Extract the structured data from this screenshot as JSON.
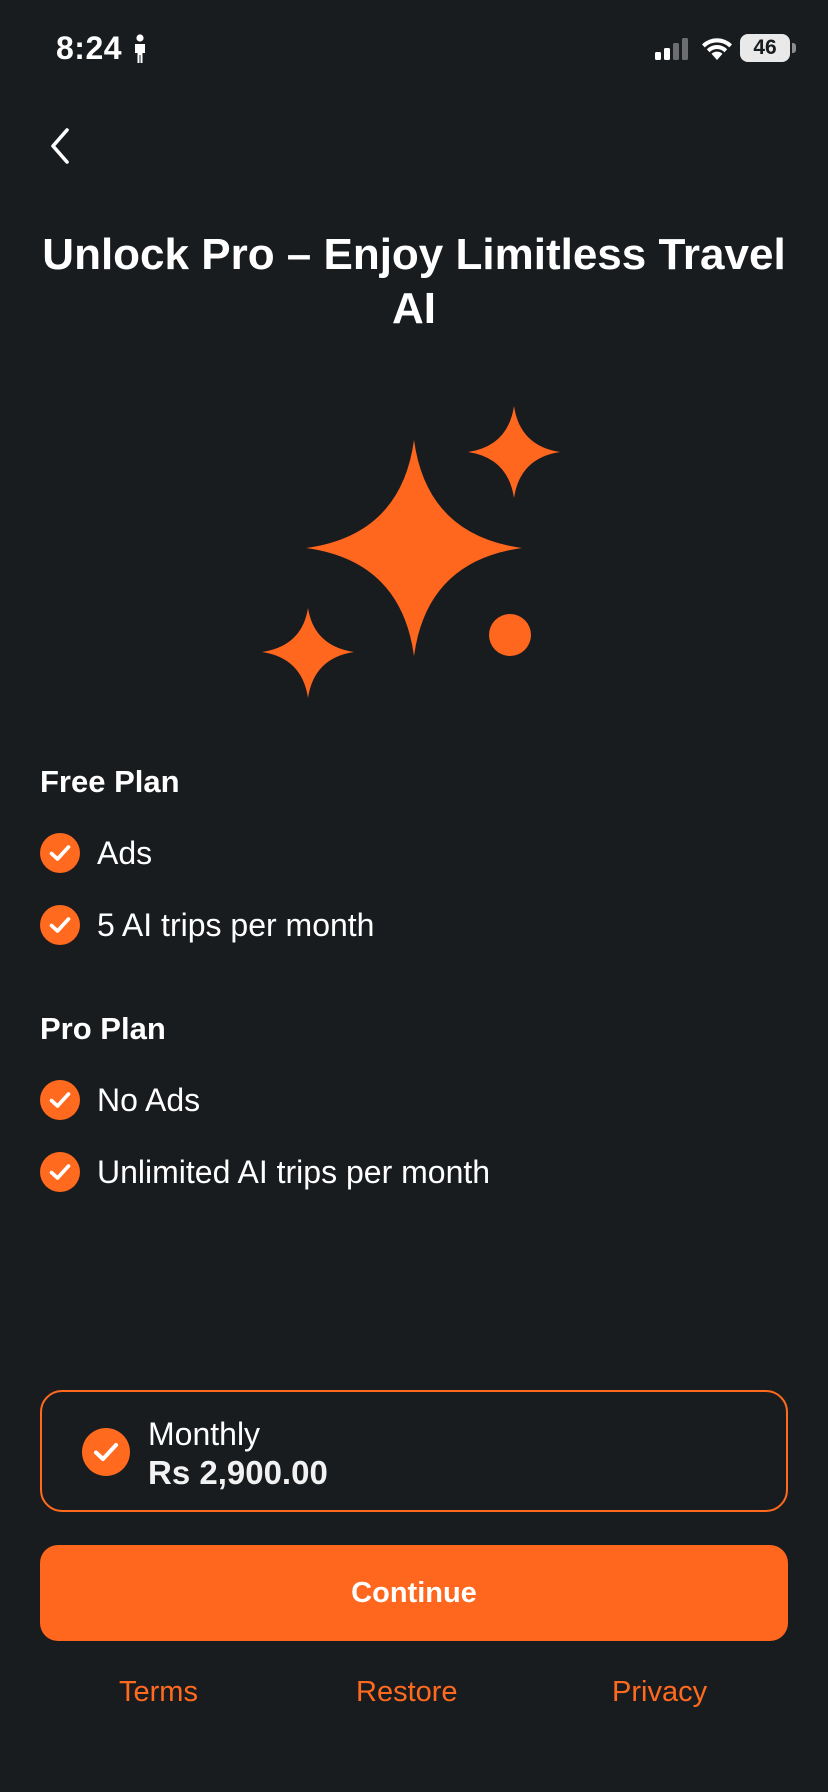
{
  "status_bar": {
    "time": "8:24",
    "battery": "46"
  },
  "colors": {
    "accent": "#ff6a1f",
    "background": "#191c1f"
  },
  "title": "Unlock Pro – Enjoy Limitless Travel AI",
  "hero_icon": "sparkles-icon",
  "free_plan": {
    "heading": "Free Plan",
    "features": [
      "Ads",
      "5 AI trips per month"
    ]
  },
  "pro_plan": {
    "heading": "Pro Plan",
    "features": [
      "No Ads",
      "Unlimited AI trips per month"
    ]
  },
  "subscription": {
    "name": "Monthly",
    "price": "Rs 2,900.00",
    "selected": true
  },
  "continue_label": "Continue",
  "footer": {
    "terms": "Terms",
    "restore": "Restore",
    "privacy": "Privacy"
  }
}
